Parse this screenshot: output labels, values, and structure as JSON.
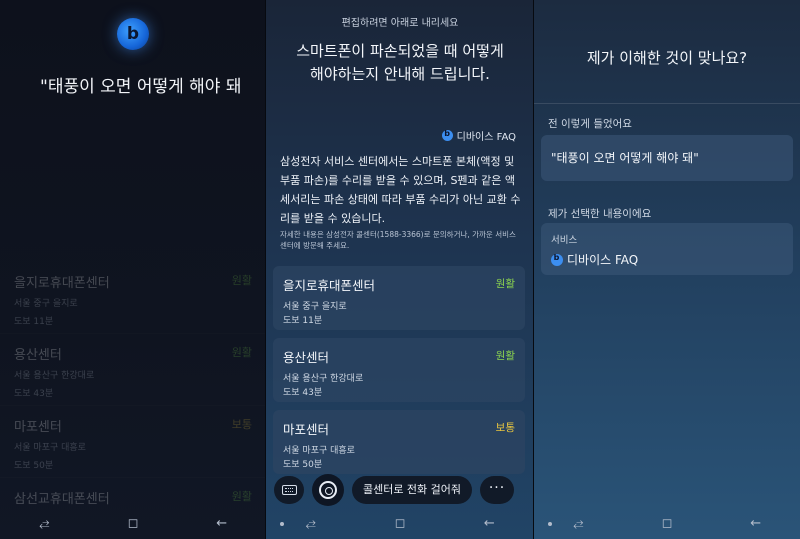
{
  "panel1": {
    "query": "\"태풍이 오면 어떻게 해야 돼",
    "centers": [
      {
        "name": "을지로휴대폰센터",
        "address": "서울 중구 을지로",
        "walk": "도보 11분",
        "status": "원활",
        "level": "good"
      },
      {
        "name": "용산센터",
        "address": "서울 용산구 한강대로",
        "walk": "도보 43분",
        "status": "원활",
        "level": "good"
      },
      {
        "name": "마포센터",
        "address": "서울 마포구 대흥로",
        "walk": "도보 50분",
        "status": "보통",
        "level": "mid"
      },
      {
        "name": "삼선교휴대폰센터",
        "address": "",
        "walk": "",
        "status": "원활",
        "level": "good"
      }
    ]
  },
  "panel2": {
    "hint": "편집하려면 아래로 내리세요",
    "title_line1": "스마트폰이 파손되었을 때 어떻게",
    "title_line2": "해야하는지 안내해 드립니다.",
    "source": "디바이스 FAQ",
    "body": "삼성전자 서비스 센터에서는 스마트폰 본체(액정 및 부품 파손)를 수리를 받을 수 있으며, S펜과 같은 액세서리는 파손 상태에 따라 부품 수리가 아닌 교환 수리를 받을 수 있습니다.",
    "small": "자세한 내용은 삼성전자 콜센터(1588-3366)로 문의하거나, 가까운 서비스 센터에 방문해 주세요.",
    "centers": [
      {
        "name": "을지로휴대폰센터",
        "address": "서울 중구 을지로",
        "walk": "도보 11분",
        "status": "원활",
        "level": "good"
      },
      {
        "name": "용산센터",
        "address": "서울 용산구 한강대로",
        "walk": "도보 43분",
        "status": "원활",
        "level": "good"
      },
      {
        "name": "마포센터",
        "address": "서울 마포구 대흥로",
        "walk": "도보 50분",
        "status": "보통",
        "level": "mid"
      }
    ],
    "call_button": "콜센터로 전화 걸어줘",
    "more_button": "···"
  },
  "panel3": {
    "title": "제가 이해한 것이 맞나요?",
    "heard_label": "전 이렇게 들었어요",
    "heard_value": "\"태풍이 오면 어떻게 해야 돼\"",
    "selected_label": "제가 선택한 내용이에요",
    "service_label": "서비스",
    "service_value": "디바이스 FAQ"
  },
  "navbar": {
    "recent": "⥄",
    "home": "◻",
    "back": "←"
  },
  "colors": {
    "status_good": "#8bd44f",
    "status_mid": "#e8c53f",
    "bixby_blue": "#3c8ef0"
  }
}
